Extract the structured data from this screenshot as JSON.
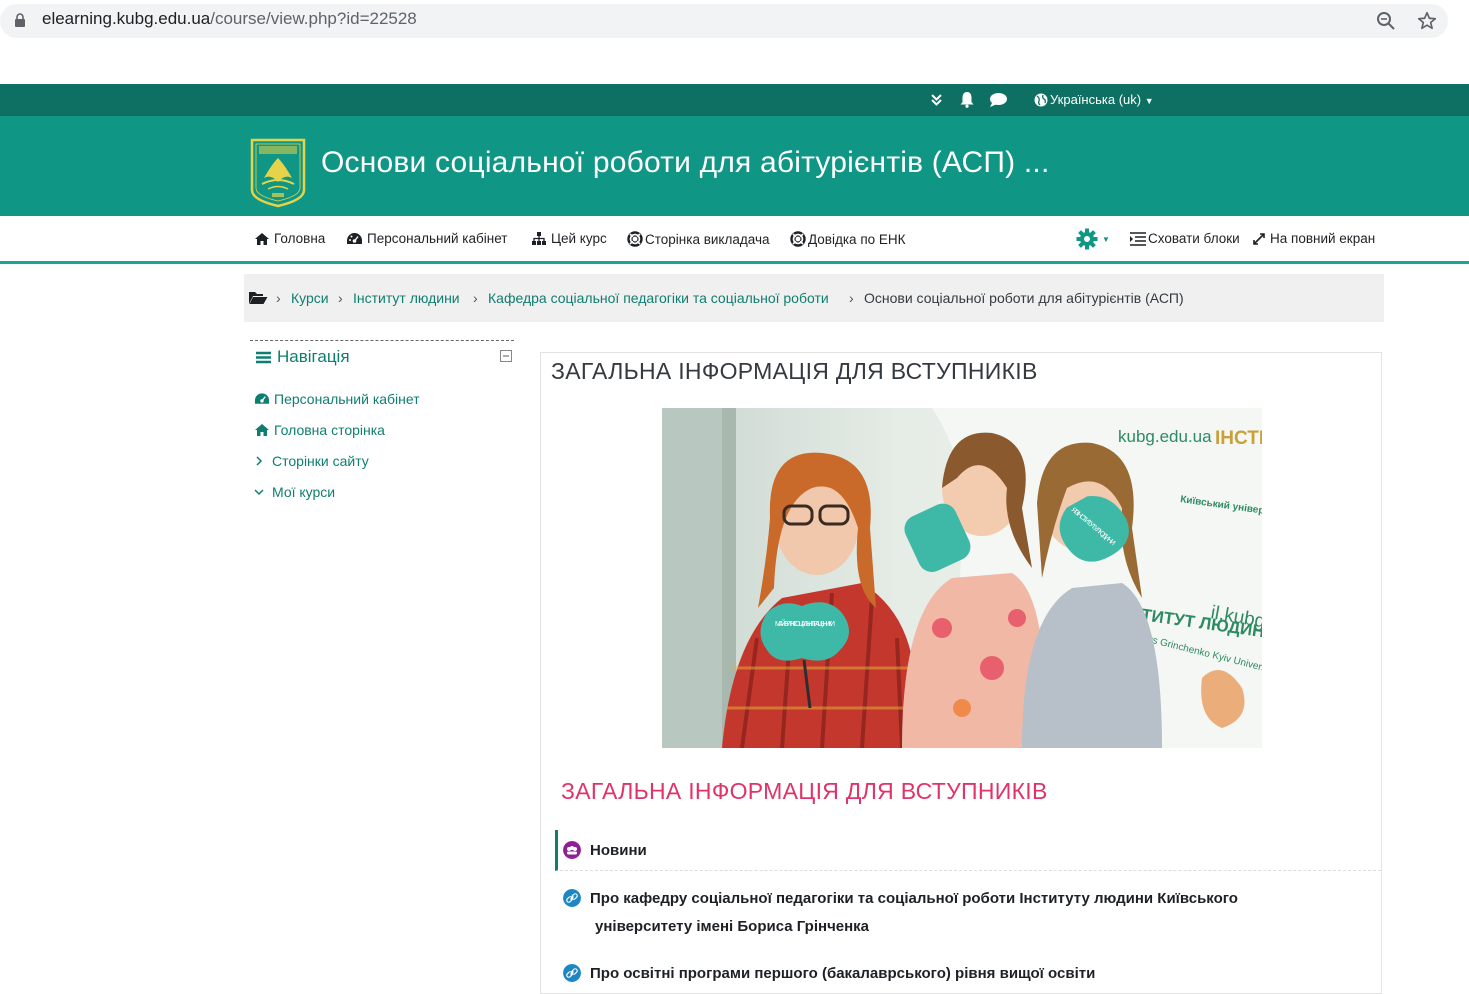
{
  "browser": {
    "url_host": "elearning.kubg.edu.ua",
    "url_path": "/course/view.php?id=22528"
  },
  "topbar": {
    "language": "Українська (uk)"
  },
  "header": {
    "course_title": "Основи соціальної роботи для абітурієнтів (АСП) ..."
  },
  "menu": {
    "items": [
      {
        "label": "Головна",
        "icon": "home-icon"
      },
      {
        "label": "Персональний кабінет",
        "icon": "dashboard-icon"
      },
      {
        "label": "Цей курс",
        "icon": "sitemap-icon"
      },
      {
        "label": "Сторінка викладача",
        "icon": "lifebuoy-icon"
      },
      {
        "label": "Довідка по ЕНК",
        "icon": "lifebuoy-icon"
      }
    ],
    "hide_blocks": "Сховати блоки",
    "fullscreen": "На повний екран"
  },
  "breadcrumb": {
    "items": [
      "Курси",
      "Інститут людини",
      "Кафедра соціальної педагогіки та соціальної роботи"
    ],
    "current": "Основи соціальної роботи для абітурієнтів (АСП)"
  },
  "navigation": {
    "title": "Навігація",
    "items": [
      {
        "label": "Персональний кабінет",
        "icon": "dashboard-icon"
      },
      {
        "label": "Головна сторінка",
        "icon": "home-icon"
      },
      {
        "label": "Сторінки сайту",
        "icon": "chevron-right-icon"
      },
      {
        "label": "Мої курси",
        "icon": "chevron-down-icon"
      }
    ]
  },
  "main": {
    "section_title": "ЗАГАЛЬНА ІНФОРМАЦІЯ ДЛЯ ВСТУПНИКІВ",
    "photo_texts": {
      "banner_site": "kubg.edu.ua",
      "banner_univ": "Київський університет імені Бориса Грінченка",
      "banner_inst": "ІНСТИТУТ ЛЮДИНИ",
      "banner_url": "il.kubg.",
      "banner_en": "Borys Grinchenko Kyiv University",
      "sign_left": "МАЙБУТНІ СОЦІАЛЬНІ ПРАЦІВНИКИ",
      "sign_right": "Я З ІНСТИТУТУ ЛЮДИНИ"
    },
    "subtitle": "ЗАГАЛЬНА ІНФОРМАЦІЯ ДЛЯ ВСТУПНИКІВ",
    "activities": [
      {
        "label": "Новини",
        "icon": "forum-icon"
      },
      {
        "label_line1": "Про кафедру соціальної педагогіки та соціальної роботи Інституту людини Київського",
        "label_line2": "університету імені Бориса Грінченка",
        "icon": "url-icon"
      },
      {
        "label": "Про освітні програми першого (бакалаврського) рівня вищої освіти",
        "icon": "url-icon"
      }
    ]
  },
  "colors": {
    "topbar": "#0e7063",
    "header": "#0f9684",
    "link": "#0f7e70",
    "pink": "#e0336a"
  }
}
